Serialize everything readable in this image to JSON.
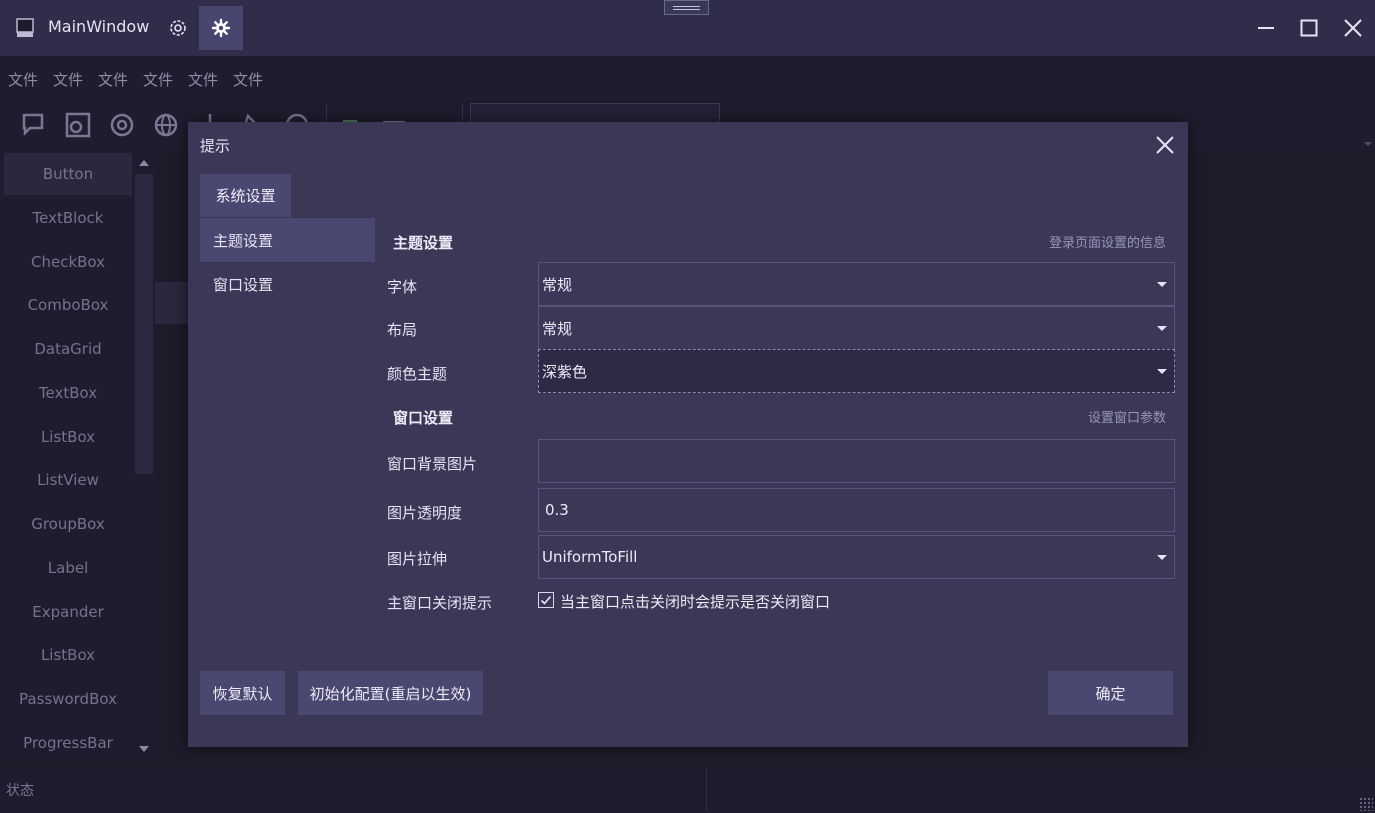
{
  "window": {
    "title": "MainWindow",
    "icons": [
      "app-icon",
      "settings-icon",
      "gear-icon",
      "minimize-icon",
      "maximize-icon",
      "close-icon"
    ]
  },
  "menu": [
    "文件",
    "文件",
    "文件",
    "文件",
    "文件",
    "文件"
  ],
  "sidebar": {
    "items": [
      "Button",
      "TextBlock",
      "CheckBox",
      "ComboBox",
      "DataGrid",
      "TextBox",
      "ListBox",
      "ListView",
      "GroupBox",
      "Label",
      "Expander",
      "ListBox",
      "PasswordBox",
      "ProgressBar"
    ],
    "selected": "Button"
  },
  "status": {
    "text": "状态"
  },
  "dialog": {
    "title": "提示",
    "tab": "系统设置",
    "nav": [
      "主题设置",
      "窗口设置"
    ],
    "theme_section": {
      "title": "主题设置",
      "hint": "登录页面设置的信息",
      "font_label": "字体",
      "font_value": "常规",
      "layout_label": "布局",
      "layout_value": "常规",
      "color_label": "颜色主题",
      "color_value": "深紫色"
    },
    "window_section": {
      "title": "窗口设置",
      "hint": "设置窗口参数",
      "bg_image_label": "窗口背景图片",
      "bg_image_value": "",
      "opacity_label": "图片透明度",
      "opacity_value": "0.3",
      "stretch_label": "图片拉伸",
      "stretch_value": "UniformToFill",
      "close_prompt_label": "主窗口关闭提示",
      "close_prompt_checked": true,
      "close_prompt_text": "当主窗口点击关闭时会提示是否关闭窗口"
    },
    "buttons": {
      "reset": "恢复默认",
      "init": "初始化配置(重启以生效)",
      "ok": "确定"
    }
  },
  "colors": {
    "titlebar": "#2f2d4a",
    "background": "#1c1c2b",
    "dialog": "#3a3757",
    "accent": "#4a4770"
  }
}
